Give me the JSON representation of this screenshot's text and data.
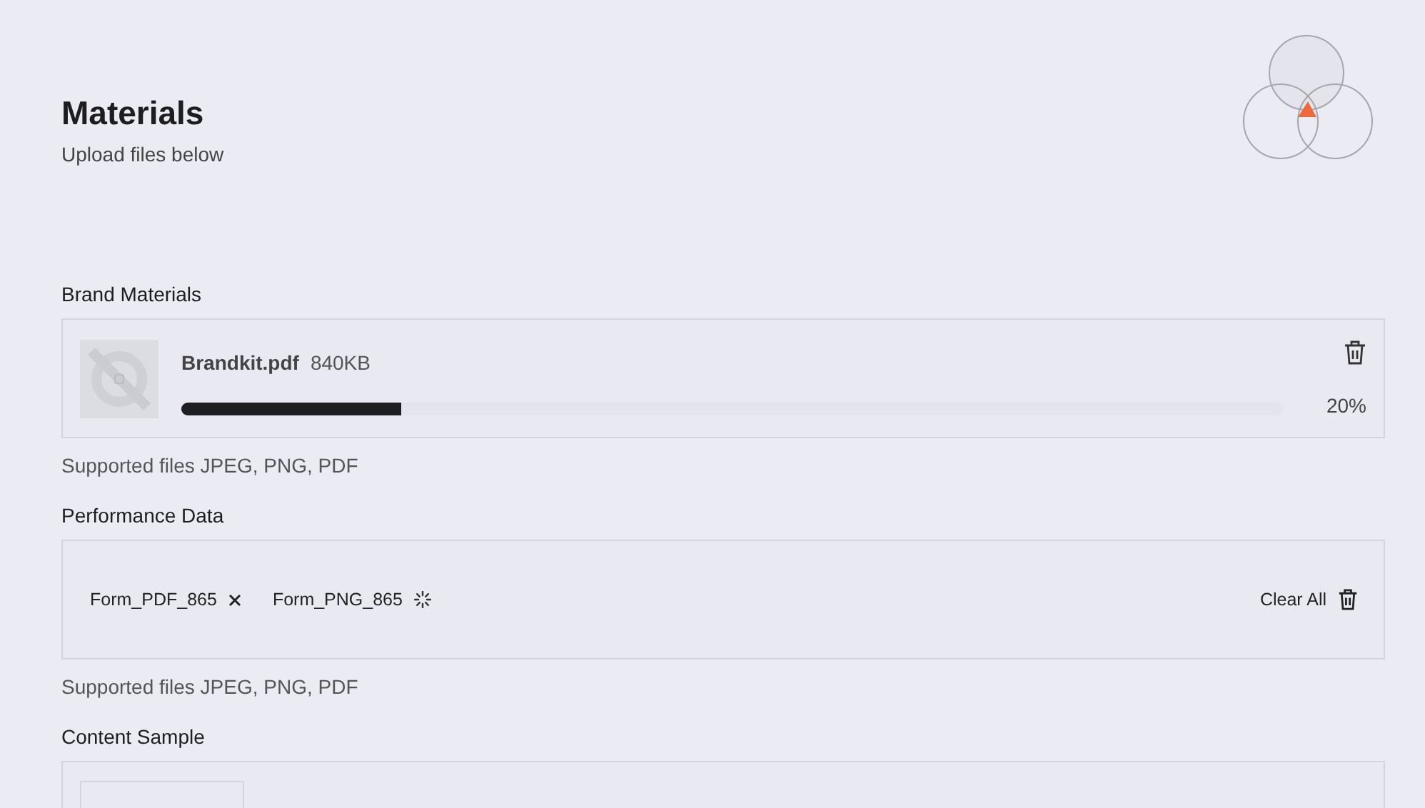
{
  "header": {
    "title": "Materials",
    "subtitle": "Upload files below"
  },
  "sections": [
    {
      "label": "Brand Materials",
      "kind": "file",
      "file": {
        "name": "Brandkit.pdf",
        "size": "840KB",
        "level": 0.2,
        "percent": "20%"
      },
      "hint": "Supported files JPEG, PNG, PDF"
    },
    {
      "label": "Performance Data",
      "kind": "chips",
      "chips": [
        {
          "name": "Form_PDF_865",
          "kind": "removable"
        },
        {
          "name": "Form_PNG_865",
          "kind": "uploading"
        }
      ],
      "clear": "Clear All",
      "hint": "Supported files JPEG, PNG, PDF"
    },
    {
      "label": "Content Sample",
      "kind": "thumb"
    }
  ]
}
